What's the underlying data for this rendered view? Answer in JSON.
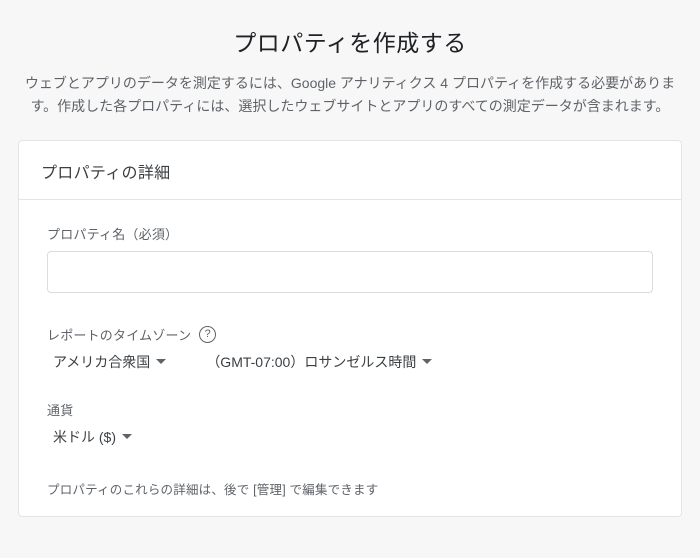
{
  "page": {
    "title": "プロパティを作成する",
    "description": "ウェブとアプリのデータを測定するには、Google アナリティクス 4 プロパティを作成する必要があります。作成した各プロパティには、選択したウェブサイトとアプリのすべての測定データが含まれます。"
  },
  "card": {
    "header": "プロパティの詳細",
    "property_name": {
      "label": "プロパティ名（必須）",
      "value": ""
    },
    "timezone": {
      "label": "レポートのタイムゾーン",
      "country": "アメリカ合衆国",
      "zone": "（GMT-07:00）ロサンゼルス時間"
    },
    "currency": {
      "label": "通貨",
      "value": "米ドル ($)"
    },
    "hint": "プロパティのこれらの詳細は、後で [管理] で編集できます"
  }
}
